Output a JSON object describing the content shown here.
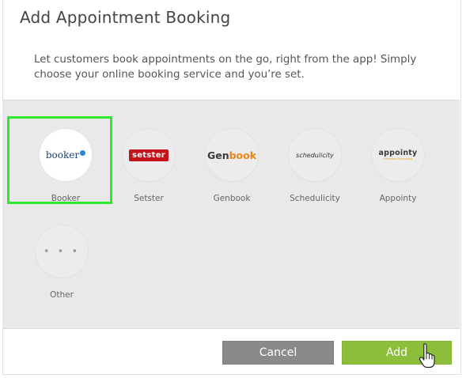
{
  "dialog": {
    "title": "Add Appointment Booking",
    "description": "Let customers book appointments on the go, right from the app! Simply choose your online booking service and you’re set."
  },
  "services": [
    {
      "label": "Booker",
      "logo_text": "booker",
      "icon": "booker-logo"
    },
    {
      "label": "Setster",
      "logo_text": "setster",
      "icon": "setster-logo"
    },
    {
      "label": "Genbook",
      "logo_text_main": "Gen",
      "logo_text_accent": "book",
      "icon": "genbook-logo"
    },
    {
      "label": "Schedulicity",
      "logo_text": "schedulicity",
      "icon": "schedulicity-logo"
    },
    {
      "label": "Appointy",
      "logo_text": "appointy",
      "logo_tagline": "Effortless Scheduling",
      "icon": "appointy-logo"
    },
    {
      "label": "Other",
      "logo_text": "• • •",
      "icon": "more-dots-icon",
      "selected": true
    }
  ],
  "buttons": {
    "cancel": "Cancel",
    "add": "Add"
  },
  "colors": {
    "selection_border": "#2ee82e",
    "add_button": "#8cbd3b",
    "cancel_button": "#8a8a8a",
    "grid_background": "#e9e9e9"
  }
}
